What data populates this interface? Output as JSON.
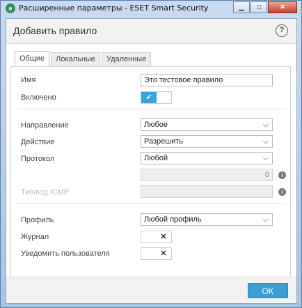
{
  "window": {
    "title": "Расширенные параметры - ESET Smart Security",
    "app_icon": "e",
    "minimize": "▁",
    "maximize": "□",
    "close": "✕"
  },
  "dialog": {
    "title": "Добавить правило",
    "help": "?"
  },
  "tabs": [
    {
      "label": "Общие",
      "active": true
    },
    {
      "label": "Локальные",
      "active": false
    },
    {
      "label": "Удаленные",
      "active": false
    }
  ],
  "form": {
    "name_label": "Имя",
    "name_value": "Это тестовое правило",
    "enabled_label": "Включено",
    "enabled_on": "✔",
    "direction_label": "Направление",
    "direction_value": "Любое",
    "action_label": "Действие",
    "action_value": "Разрешить",
    "protocol_label": "Протокол",
    "protocol_value": "Любой",
    "protocol_number": "0",
    "icmp_label": "Тип/код ICMP",
    "icmp_value": "",
    "profile_label": "Профиль",
    "profile_value": "Любой профиль",
    "log_label": "Журнал",
    "log_off": "✕",
    "notify_label": "Уведомить пользователя",
    "notify_off": "✕",
    "chevron": "⌵",
    "info": "i"
  },
  "footer": {
    "ok_label": "OK"
  },
  "colors": {
    "accent": "#3b9fd7",
    "toggle_on": "#3aa3d9"
  }
}
